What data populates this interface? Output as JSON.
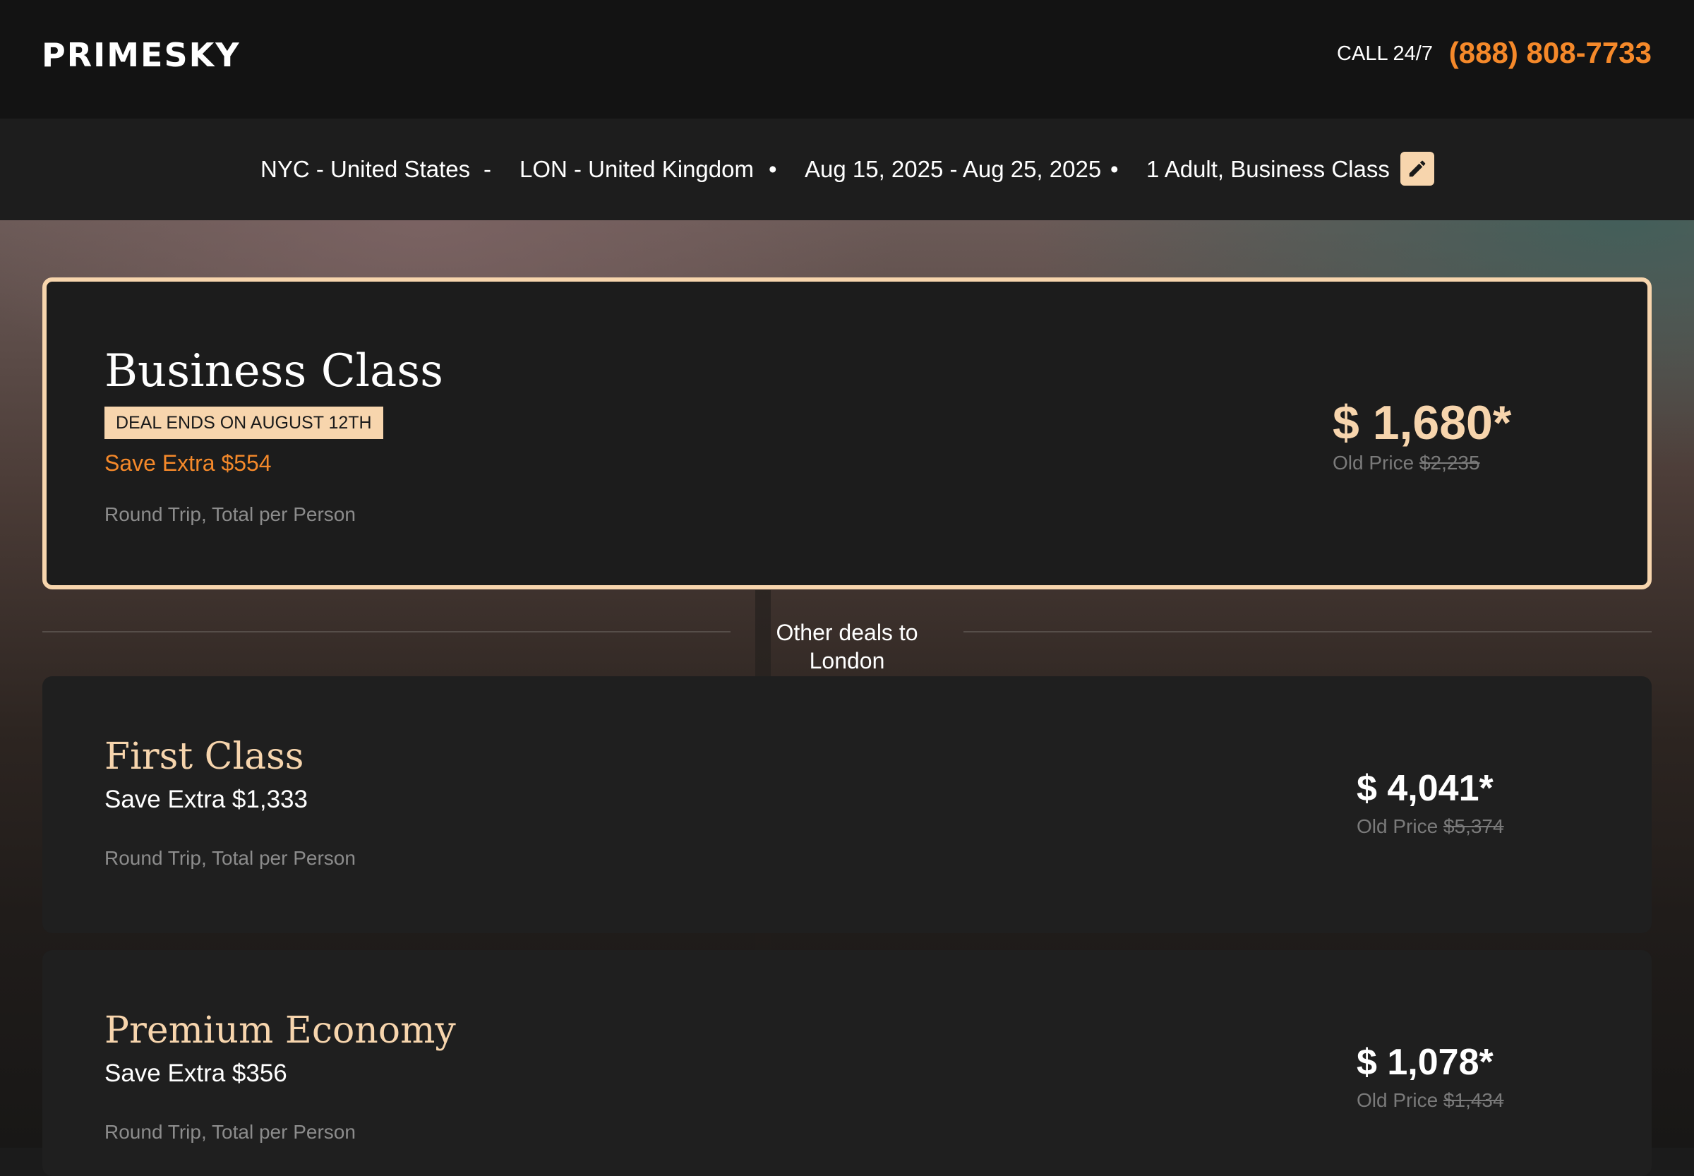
{
  "header": {
    "logo": "PRIMESKY",
    "call_label": "CALL 24/7",
    "phone": "(888) 808-7733"
  },
  "search_summary": {
    "origin": "NYC - United States",
    "route_separator": "-",
    "destination": "LON - United Kingdom",
    "dot": "•",
    "dates": "Aug 15, 2025 - Aug 25, 2025",
    "passengers": "1 Adult, Business Class",
    "edit_icon": "pencil-icon"
  },
  "featured_deal": {
    "title": "Business Class",
    "badge": "DEAL ENDS ON AUGUST 12TH",
    "save_extra": "Save Extra $554",
    "trip_note": "Round Trip, Total per Person",
    "price": "$ 1,680*",
    "old_price_label": "Old Price",
    "old_price": "$2,235"
  },
  "other_deals_label": "Other deals to London",
  "other_deals": [
    {
      "title": "First Class",
      "save_extra": "Save Extra $1,333",
      "trip_note": "Round Trip, Total per Person",
      "price": "$ 4,041*",
      "old_price_label": "Old Price",
      "old_price": "$5,374"
    },
    {
      "title": "Premium Economy",
      "save_extra": "Save Extra $356",
      "trip_note": "Round Trip, Total per Person",
      "price": "$ 1,078*",
      "old_price_label": "Old Price",
      "old_price": "$1,434"
    }
  ],
  "colors": {
    "accent_orange": "#f5892a",
    "accent_peach": "#f7d5ad",
    "card_bg": "#1c1c1c",
    "header_bg": "#131313"
  }
}
